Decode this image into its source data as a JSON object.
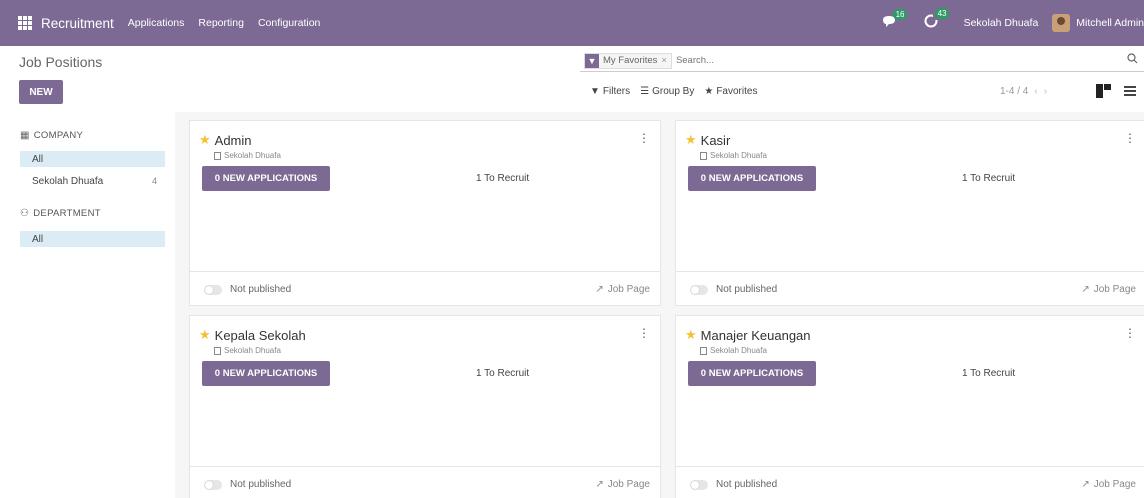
{
  "navbar": {
    "app_name": "Recruitment",
    "menus": [
      "Applications",
      "Reporting",
      "Configuration"
    ],
    "messages_badge": "16",
    "activities_badge": "43",
    "company": "Sekolah Dhuafa",
    "user": "Mitchell Admin",
    "color": "#7c6a95"
  },
  "control": {
    "breadcrumb": "Job Positions",
    "new_label": "NEW",
    "facet_label": "My Favorites",
    "facet_close": "×",
    "search_placeholder": "Search...",
    "filters_label": "Filters",
    "groupby_label": "Group By",
    "favorites_label": "Favorites",
    "pager": "1-4 / 4"
  },
  "sidebar": {
    "company_header": "COMPANY",
    "company_items": [
      {
        "label": "All",
        "count": ""
      },
      {
        "label": "Sekolah Dhuafa",
        "count": "4"
      }
    ],
    "department_header": "DEPARTMENT",
    "department_items": [
      {
        "label": "All"
      }
    ]
  },
  "cards": [
    {
      "title": "Admin",
      "company": "Sekolah Dhuafa",
      "button": "0 NEW APPLICATIONS",
      "recruit": "1 To Recruit",
      "published": "Not published",
      "job_page": "Job Page"
    },
    {
      "title": "Kasir",
      "company": "Sekolah Dhuafa",
      "button": "0 NEW APPLICATIONS",
      "recruit": "1 To Recruit",
      "published": "Not published",
      "job_page": "Job Page"
    },
    {
      "title": "Kepala Sekolah",
      "company": "Sekolah Dhuafa",
      "button": "0 NEW APPLICATIONS",
      "recruit": "1 To Recruit",
      "published": "Not published",
      "job_page": "Job Page"
    },
    {
      "title": "Manajer Keuangan",
      "company": "Sekolah Dhuafa",
      "button": "0 NEW APPLICATIONS",
      "recruit": "1 To Recruit",
      "published": "Not published",
      "job_page": "Job Page"
    }
  ]
}
